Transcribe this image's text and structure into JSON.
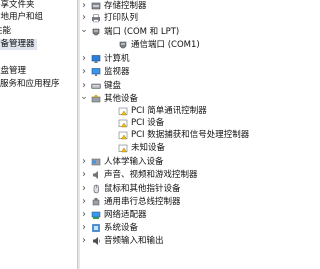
{
  "left_pane": {
    "items": [
      {
        "label": "共享文件夹",
        "selected": false
      },
      {
        "label": "本地用户和组",
        "selected": false
      },
      {
        "label": "性能",
        "selected": false
      },
      {
        "label": "设备管理器",
        "selected": true
      },
      {
        "label": "磁盘管理",
        "selected": false
      },
      {
        "label": "服务和应用程序",
        "selected": false
      }
    ]
  },
  "device_tree": {
    "nodes": [
      {
        "label": "存储控制器",
        "expander": "collapsed",
        "level": 0,
        "icon": "storage-controller-icon"
      },
      {
        "label": "打印队列",
        "expander": "collapsed",
        "level": 0,
        "icon": "printer-icon"
      },
      {
        "label": "端口 (COM 和 LPT)",
        "expander": "expanded",
        "level": 0,
        "icon": "port-icon"
      },
      {
        "label": "通信端口 (COM1)",
        "expander": "none",
        "level": 1,
        "icon": "port-icon"
      },
      {
        "label": "计算机",
        "expander": "collapsed",
        "level": 0,
        "icon": "computer-icon"
      },
      {
        "label": "监视器",
        "expander": "collapsed",
        "level": 0,
        "icon": "monitor-icon"
      },
      {
        "label": "键盘",
        "expander": "collapsed",
        "level": 0,
        "icon": "keyboard-icon"
      },
      {
        "label": "其他设备",
        "expander": "expanded",
        "level": 0,
        "icon": "unknown-device-icon"
      },
      {
        "label": "PCI 简单通讯控制器",
        "expander": "none",
        "level": 1,
        "icon": "warning-device-icon"
      },
      {
        "label": "PCI 设备",
        "expander": "none",
        "level": 1,
        "icon": "warning-device-icon"
      },
      {
        "label": "PCI 数据捕获和信号处理控制器",
        "expander": "none",
        "level": 1,
        "icon": "warning-device-icon"
      },
      {
        "label": "未知设备",
        "expander": "none",
        "level": 1,
        "icon": "warning-device-icon"
      },
      {
        "label": "人体学输入设备",
        "expander": "collapsed",
        "level": 0,
        "icon": "hid-icon"
      },
      {
        "label": "声音、视频和游戏控制器",
        "expander": "collapsed",
        "level": 0,
        "icon": "speaker-icon"
      },
      {
        "label": "鼠标和其他指针设备",
        "expander": "collapsed",
        "level": 0,
        "icon": "mouse-icon"
      },
      {
        "label": "通用串行总线控制器",
        "expander": "collapsed",
        "level": 0,
        "icon": "usb-icon"
      },
      {
        "label": "网络适配器",
        "expander": "collapsed",
        "level": 0,
        "icon": "network-adapter-icon"
      },
      {
        "label": "系统设备",
        "expander": "collapsed",
        "level": 0,
        "icon": "system-device-icon"
      },
      {
        "label": "音频输入和输出",
        "expander": "collapsed",
        "level": 0,
        "icon": "audio-io-icon"
      }
    ]
  }
}
